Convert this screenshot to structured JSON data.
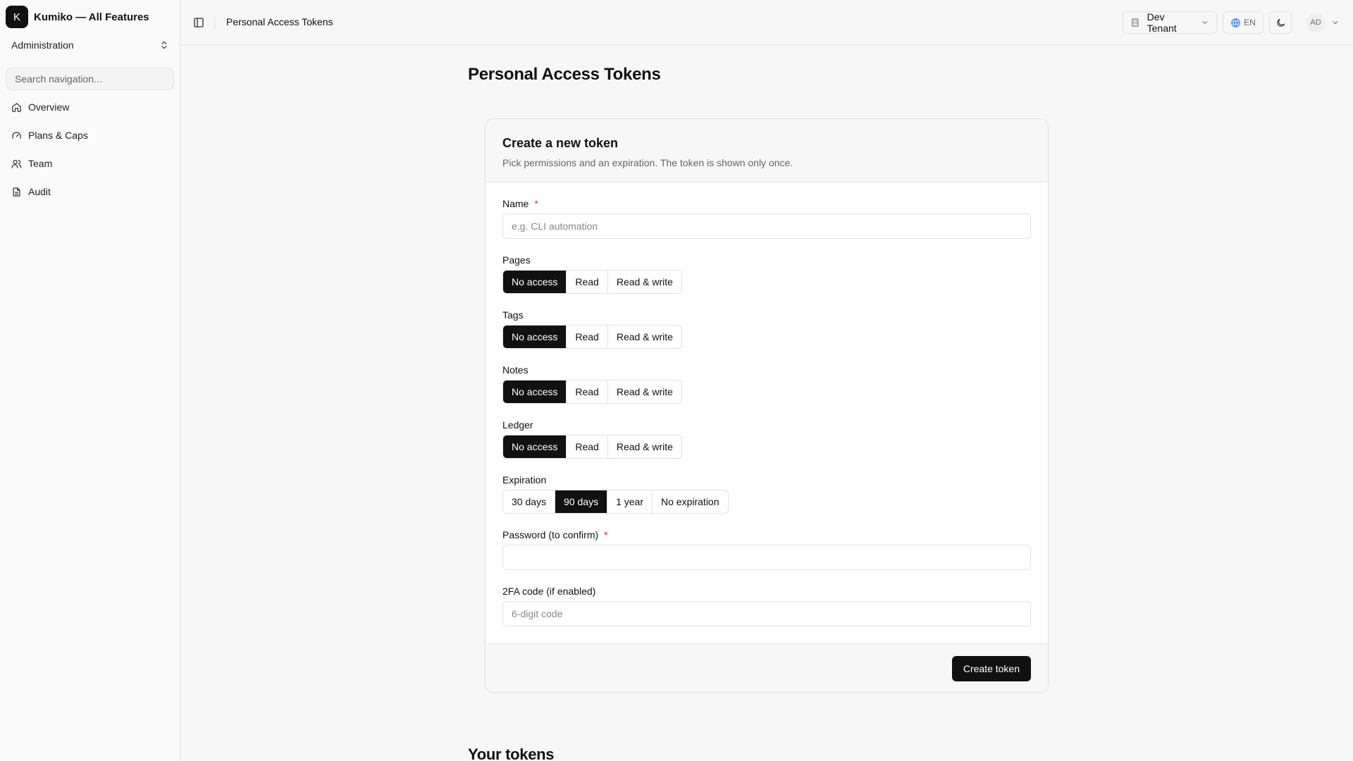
{
  "brand": {
    "logo_letter": "K",
    "name": "Kumiko — All Features"
  },
  "sidebar": {
    "section": "Administration",
    "search_placeholder": "Search navigation...",
    "items": [
      {
        "label": "Overview",
        "icon": "home-icon"
      },
      {
        "label": "Plans & Caps",
        "icon": "gauge-icon"
      },
      {
        "label": "Team",
        "icon": "users-icon"
      },
      {
        "label": "Audit",
        "icon": "file-text-icon"
      }
    ]
  },
  "topbar": {
    "title": "Personal Access Tokens",
    "tenant": "Dev Tenant",
    "language": "EN",
    "user_initials": "AD"
  },
  "page": {
    "title": "Personal Access Tokens",
    "tokens_section_title": "Your tokens"
  },
  "form": {
    "title": "Create a new token",
    "description": "Pick permissions and an expiration. The token is shown only once.",
    "required_mark": "*",
    "name": {
      "label": "Name",
      "placeholder": "e.g. CLI automation",
      "value": ""
    },
    "permission_options": [
      "No access",
      "Read",
      "Read & write"
    ],
    "permissions": [
      {
        "label": "Pages",
        "selected": "No access"
      },
      {
        "label": "Tags",
        "selected": "No access"
      },
      {
        "label": "Notes",
        "selected": "No access"
      },
      {
        "label": "Ledger",
        "selected": "No access"
      }
    ],
    "expiration": {
      "label": "Expiration",
      "options": [
        "30 days",
        "90 days",
        "1 year",
        "No expiration"
      ],
      "selected": "90 days"
    },
    "password": {
      "label": "Password (to confirm)",
      "value": ""
    },
    "twofa": {
      "label": "2FA code (if enabled)",
      "placeholder": "6-digit code",
      "value": ""
    },
    "submit_label": "Create token"
  },
  "colors": {
    "accent": "#111111",
    "required": "#e11d48",
    "border": "#e2e2e2",
    "background": "#f7f7f7"
  }
}
